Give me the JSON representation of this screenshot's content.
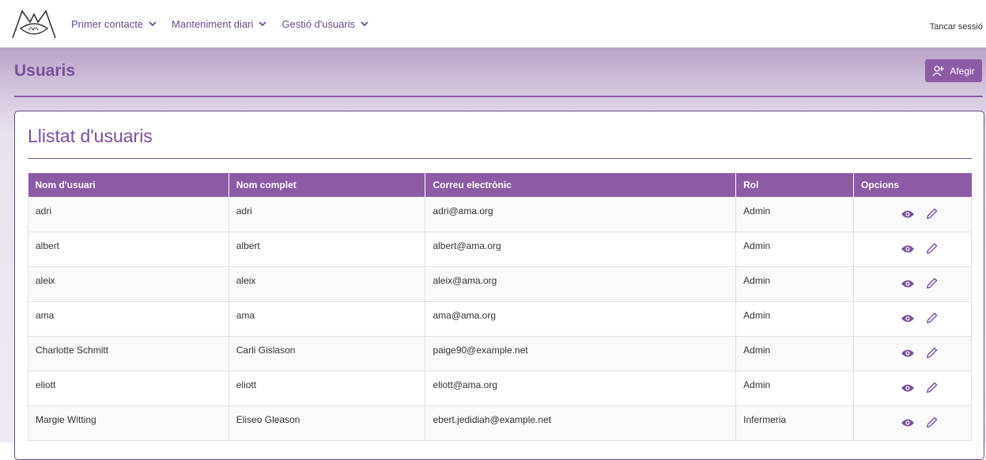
{
  "nav": {
    "items": [
      {
        "label": "Primer contacte"
      },
      {
        "label": "Manteniment diari"
      },
      {
        "label": "Gestió d'usuaris"
      }
    ],
    "logout": "Tancar sessió"
  },
  "page": {
    "title": "Usuaris",
    "add_label": "Afegir"
  },
  "card": {
    "title": "Llistat d'usuaris"
  },
  "table": {
    "headers": [
      "Nom d'usuari",
      "Nom complet",
      "Correu electrònic",
      "Rol",
      "Opcions"
    ],
    "rows": [
      [
        "adri",
        "adri",
        "adri@ama.org",
        "Admin"
      ],
      [
        "albert",
        "albert",
        "albert@ama.org",
        "Admin"
      ],
      [
        "aleix",
        "aleix",
        "aleix@ama.org",
        "Admin"
      ],
      [
        "ama",
        "ama",
        "ama@ama.org",
        "Admin"
      ],
      [
        "Charlotte Schmitt",
        "Carli Gislason",
        "paige90@example.net",
        "Admin"
      ],
      [
        "eliott",
        "eliott",
        "eliott@ama.org",
        "Admin"
      ],
      [
        "Margie Witting",
        "Eliseo Gleason",
        "ebert.jedidiah@example.net",
        "Infermeria"
      ]
    ]
  },
  "colors": {
    "accent": "#8d5aa6",
    "title": "#7b4f9c"
  },
  "icons": [
    "logo-icon",
    "chevron-down-icon",
    "add-user-icon",
    "eye-icon",
    "pencil-icon"
  ]
}
